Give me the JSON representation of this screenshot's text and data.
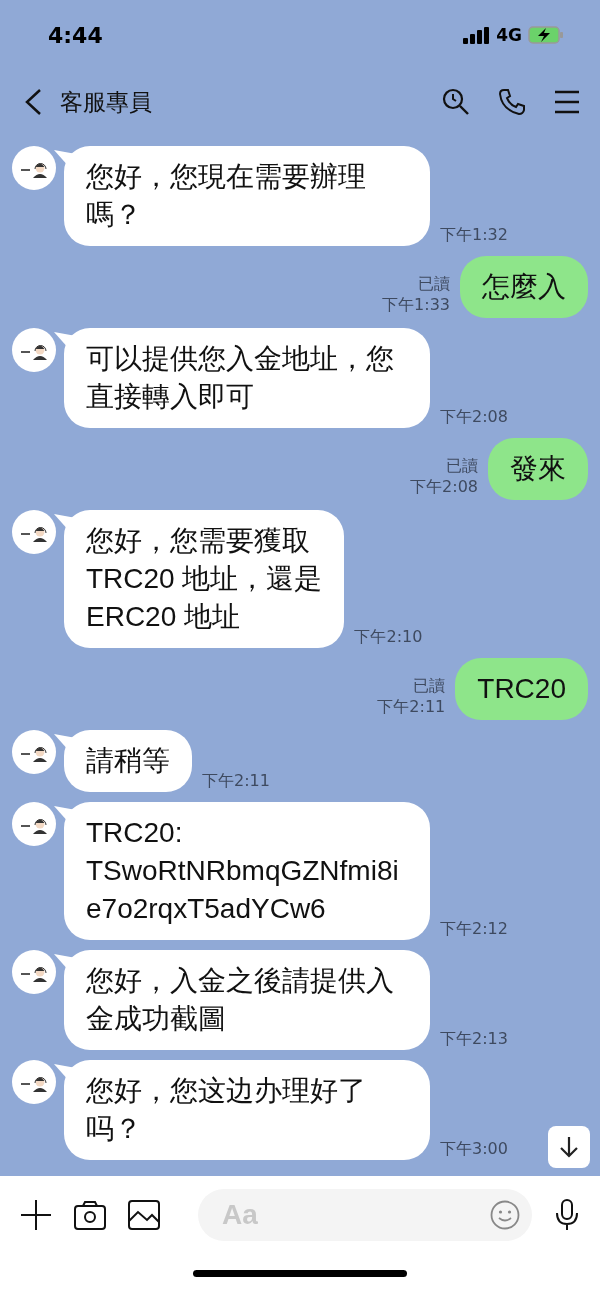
{
  "status_bar": {
    "time": "4:44",
    "network": "4G"
  },
  "header": {
    "title": "客服專員"
  },
  "messages": [
    {
      "kind": "incoming",
      "text": "您好，您現在需要辦理嗎？",
      "time": "下午1:32"
    },
    {
      "kind": "outgoing",
      "text": "怎麼入",
      "read": "已讀",
      "time": "下午1:33"
    },
    {
      "kind": "incoming",
      "text": "可以提供您入金地址，您直接轉入即可",
      "time": "下午2:08"
    },
    {
      "kind": "outgoing",
      "text": "發來",
      "read": "已讀",
      "time": "下午2:08"
    },
    {
      "kind": "incoming",
      "text": "您好，您需要獲取\nTRC20 地址，還是\nERC20 地址",
      "time": "下午2:10"
    },
    {
      "kind": "outgoing",
      "text": "TRC20",
      "read": "已讀",
      "time": "下午2:11"
    },
    {
      "kind": "incoming",
      "text": "請稍等",
      "time": "下午2:11"
    },
    {
      "kind": "incoming",
      "text": "TRC20:\nTSwoRtNRbmqGZNfmi8ie7o2rqxT5adYCw6",
      "time": "下午2:12"
    },
    {
      "kind": "incoming",
      "text": "您好，入金之後請提供入金成功截圖",
      "time": "下午2:13"
    },
    {
      "kind": "incoming",
      "text": "您好，您这边办理好了吗？",
      "time": "下午3:00"
    }
  ],
  "composer": {
    "placeholder": "Aa"
  }
}
